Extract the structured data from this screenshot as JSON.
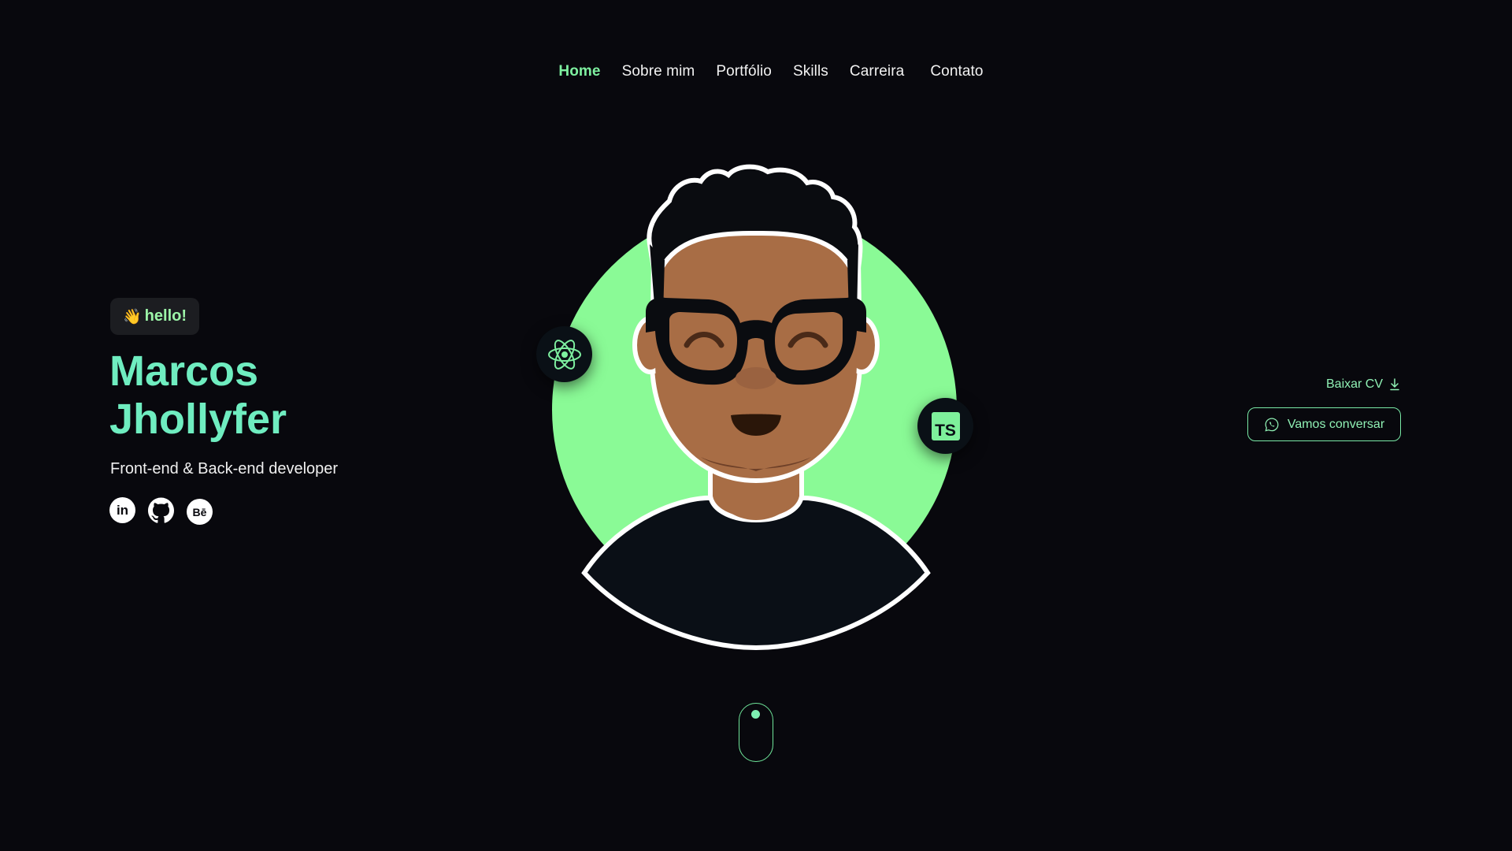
{
  "nav": {
    "items": [
      {
        "label": "Home",
        "active": true
      },
      {
        "label": "Sobre mim",
        "active": false
      },
      {
        "label": "Portfólio",
        "active": false
      },
      {
        "label": "Skills",
        "active": false
      },
      {
        "label": "Carreira",
        "active": false
      },
      {
        "label": "Contato",
        "active": false
      }
    ]
  },
  "intro": {
    "greeting_emoji": "👋",
    "greeting": "hello!",
    "name_line1": "Marcos",
    "name_line2": "Jhollyfer",
    "role": "Front-end & Back-end developer"
  },
  "socials": [
    {
      "name": "linkedin",
      "icon": "linkedin-icon",
      "glyph": "in"
    },
    {
      "name": "github",
      "icon": "github-icon"
    },
    {
      "name": "behance",
      "icon": "behance-icon",
      "glyph": "Bē"
    }
  ],
  "skills": {
    "react": "react-icon",
    "typescript": "TS"
  },
  "actions": {
    "cv_label": "Baixar CV",
    "chat_label": "Vamos conversar"
  },
  "colors": {
    "accent": "#7ef0a0",
    "name": "#6fedc0",
    "avatar_circle": "#8afa96",
    "background": "#08080d"
  }
}
